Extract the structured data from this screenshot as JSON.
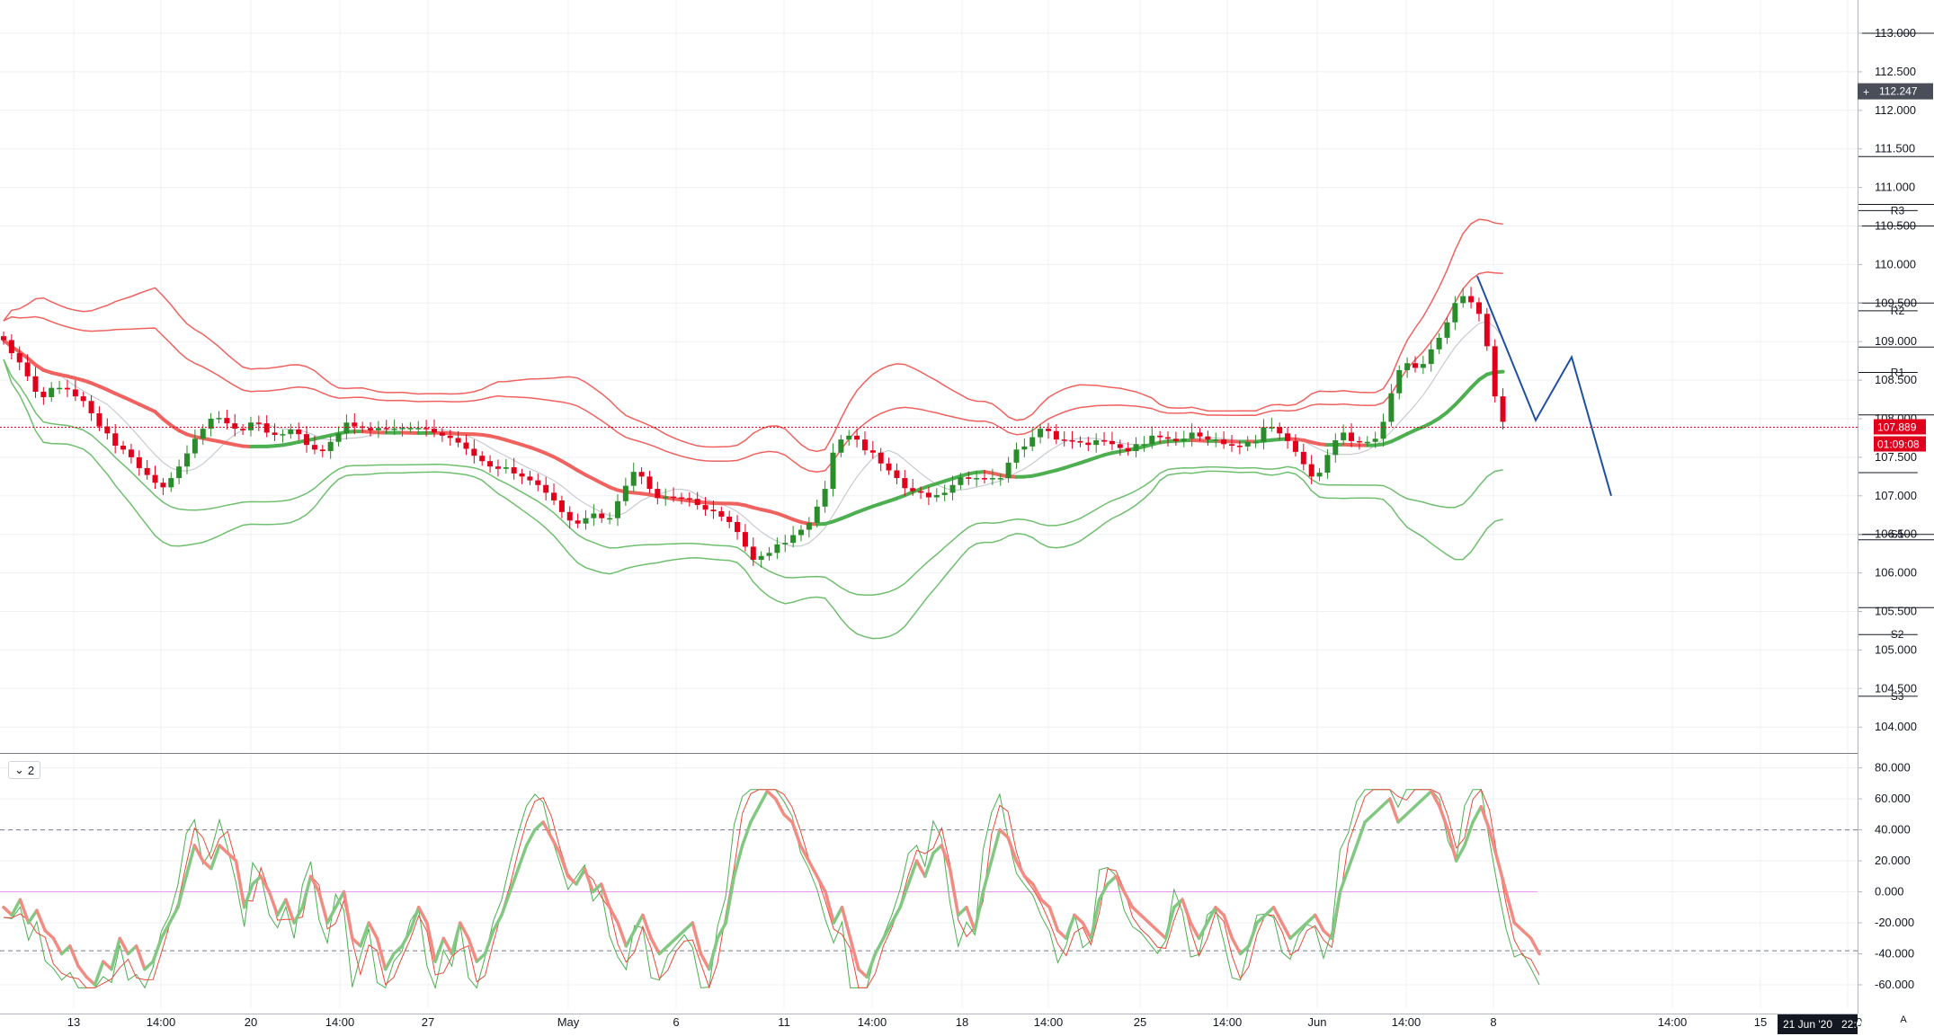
{
  "chart_data": {
    "type": "candlestick",
    "symbol_pane": "main",
    "price_axis": {
      "ylim": [
        103.5,
        113.5
      ],
      "ticks": [
        "113.000",
        "112.500",
        "112.000",
        "111.500",
        "111.000",
        "110.500",
        "110.000",
        "109.500",
        "109.000",
        "108.500",
        "108.000",
        "107.500",
        "107.000",
        "106.500",
        "106.000",
        "105.500",
        "105.000",
        "104.500",
        "104.000"
      ],
      "tick_values": [
        113,
        112.5,
        112,
        111.5,
        111,
        110.5,
        110,
        109.5,
        109,
        108.5,
        108,
        107.5,
        107,
        106.5,
        106,
        105.5,
        105,
        104.5,
        104
      ]
    },
    "time_axis": {
      "labels": [
        "13",
        "14:00",
        "20",
        "14:00",
        "27",
        "May",
        "6",
        "11",
        "14:00",
        "18",
        "14:00",
        "25",
        "14:00",
        "Jun",
        "14:00",
        "8",
        "14:00",
        "15",
        "14:00"
      ],
      "crosshair_label": "21 Jun '20",
      "crosshair_time": "22:00"
    },
    "last_price": "107.889",
    "countdown": "01:09:08",
    "crosshair_price": "112.247",
    "last_price_value": 107.889,
    "crosshair_price_value": 112.247,
    "pivots": [
      {
        "label": "R3",
        "value": 110.7,
        "start_slot": 240,
        "end_slot": 999
      },
      {
        "label": "R2",
        "value": 109.4,
        "start_slot": 240,
        "end_slot": 999
      },
      {
        "label": "R1",
        "value": 108.6,
        "start_slot": 240,
        "end_slot": 999
      },
      {
        "label": "",
        "value": 107.3,
        "start_slot": 240,
        "end_slot": 999
      },
      {
        "label": "S1",
        "value": 106.5,
        "start_slot": 240,
        "end_slot": 999
      },
      {
        "label": "S2",
        "value": 105.2,
        "start_slot": 240,
        "end_slot": 999
      },
      {
        "label": "S3",
        "value": 104.4,
        "start_slot": 240,
        "end_slot": 999
      },
      {
        "label": "R3",
        "value": 113.0,
        "start_slot": 271,
        "end_slot": 302
      },
      {
        "label": "R2",
        "value": 111.4,
        "start_slot": 271,
        "end_slot": 302
      },
      {
        "label": "R1",
        "value": 110.5,
        "start_slot": 271,
        "end_slot": 302
      },
      {
        "label": "P",
        "value": 108.93,
        "start_slot": 271,
        "end_slot": 302
      },
      {
        "label": "S1",
        "value": 108.05,
        "start_slot": 271,
        "end_slot": 302
      },
      {
        "label": "S2",
        "value": 106.5,
        "start_slot": 271,
        "end_slot": 302
      },
      {
        "label": "S3",
        "value": 105.55,
        "start_slot": 271,
        "end_slot": 302
      },
      {
        "label": "R3",
        "value": 110.78,
        "start_slot": 278,
        "end_slot": 285
      },
      {
        "label": "P",
        "value": 109.5,
        "start_slot": 271,
        "end_slot": 278
      },
      {
        "label": "S3",
        "value": 106.43,
        "start_slot": 278,
        "end_slot": 285
      }
    ],
    "closes": [
      109.02,
      108.85,
      108.73,
      108.55,
      108.35,
      108.28,
      108.4,
      108.4,
      108.38,
      108.29,
      108.23,
      108.07,
      107.9,
      107.81,
      107.65,
      107.6,
      107.5,
      107.36,
      107.27,
      107.17,
      107.11,
      107.23,
      107.38,
      107.55,
      107.74,
      107.87,
      108.0,
      108.01,
      107.94,
      107.87,
      107.85,
      107.95,
      107.94,
      107.82,
      107.79,
      107.8,
      107.86,
      107.8,
      107.66,
      107.6,
      107.58,
      107.7,
      107.81,
      107.95,
      107.9,
      107.88,
      107.85,
      107.88,
      107.87,
      107.87,
      107.88,
      107.88,
      107.88,
      107.87,
      107.82,
      107.78,
      107.75,
      107.69,
      107.61,
      107.52,
      107.45,
      107.38,
      107.35,
      107.37,
      107.29,
      107.25,
      107.2,
      107.14,
      107.04,
      106.94,
      106.79,
      106.68,
      106.64,
      106.71,
      106.77,
      106.71,
      106.71,
      106.93,
      107.13,
      107.31,
      107.25,
      107.09,
      106.97,
      106.99,
      106.98,
      106.97,
      106.96,
      106.88,
      106.82,
      106.8,
      106.73,
      106.66,
      106.53,
      106.34,
      106.17,
      106.22,
      106.26,
      106.37,
      106.39,
      106.49,
      106.56,
      106.65,
      106.86,
      107.09,
      107.56,
      107.73,
      107.78,
      107.73,
      107.59,
      107.56,
      107.42,
      107.33,
      107.23,
      107.1,
      107.06,
      107.04,
      106.98,
      107.01,
      107.04,
      107.14,
      107.24,
      107.22,
      107.23,
      107.22,
      107.23,
      107.23,
      107.43,
      107.6,
      107.64,
      107.76,
      107.87,
      107.84,
      107.73,
      107.72,
      107.71,
      107.69,
      107.66,
      107.72,
      107.71,
      107.67,
      107.62,
      107.58,
      107.67,
      107.67,
      107.78,
      107.76,
      107.74,
      107.71,
      107.74,
      107.82,
      107.77,
      107.73,
      107.73,
      107.67,
      107.65,
      107.64,
      107.7,
      107.7,
      107.89,
      107.89,
      107.81,
      107.71,
      107.57,
      107.41,
      107.25,
      107.3,
      107.53,
      107.72,
      107.82,
      107.71,
      107.7,
      107.7,
      107.74,
      107.96,
      108.33,
      108.63,
      108.72,
      108.66,
      108.71,
      108.9,
      109.05,
      109.25,
      109.5,
      109.59,
      109.51,
      109.36,
      108.94,
      108.29,
      107.96
    ]
  },
  "indicator_pane": {
    "pane_label": "2",
    "ylim": [
      -70,
      85
    ],
    "ticks": [
      "80.000",
      "60.000",
      "40.000",
      "20.000",
      "0.000",
      "-20.000",
      "-40.000",
      "-60.000"
    ],
    "tick_values": [
      80,
      60,
      40,
      20,
      0,
      -20,
      -40,
      -60
    ],
    "dashed_levels": [
      40,
      -38
    ],
    "zero_level": 0,
    "thick_line": [
      -10,
      -15,
      -5,
      -20,
      -12,
      -25,
      -30,
      -40,
      -35,
      -48,
      -55,
      -60,
      -45,
      -50,
      -30,
      -40,
      -35,
      -50,
      -45,
      -30,
      -20,
      -10,
      10,
      30,
      20,
      15,
      30,
      25,
      20,
      -10,
      5,
      10,
      0,
      -15,
      -5,
      -20,
      -10,
      10,
      0,
      -20,
      -10,
      0,
      -30,
      -35,
      -20,
      -30,
      -50,
      -40,
      -35,
      -25,
      -10,
      -20,
      -45,
      -30,
      -40,
      -20,
      -30,
      -45,
      -40,
      -25,
      -15,
      0,
      15,
      30,
      40,
      45,
      35,
      25,
      10,
      5,
      15,
      0,
      5,
      -10,
      -20,
      -35,
      -25,
      -15,
      -30,
      -40,
      -35,
      -30,
      -25,
      -20,
      -40,
      -50,
      -30,
      -20,
      10,
      30,
      45,
      55,
      65,
      60,
      50,
      45,
      30,
      20,
      10,
      0,
      -20,
      -10,
      -30,
      -50,
      -55,
      -40,
      -30,
      -20,
      -10,
      5,
      20,
      10,
      25,
      30,
      15,
      -15,
      -10,
      -25,
      0,
      20,
      40,
      35,
      20,
      10,
      5,
      -5,
      -10,
      -25,
      -30,
      -15,
      -20,
      -30,
      -5,
      5,
      10,
      0,
      -10,
      -15,
      -20,
      -25,
      -30,
      -10,
      -5,
      -20,
      -30,
      -20,
      -10,
      -15,
      -30,
      -40,
      -35,
      -20,
      -15,
      -10,
      -20,
      -30,
      -25,
      -20,
      -15,
      -25,
      -30,
      0,
      15,
      30,
      45,
      50,
      55,
      60,
      45,
      50,
      55,
      60,
      65,
      55,
      40,
      20,
      30,
      45,
      55,
      40,
      20,
      0,
      -20,
      -25,
      -30,
      -40
    ]
  },
  "drawings": {
    "blue_path_prices": [
      109.85,
      107.98,
      108.8,
      107.0
    ]
  },
  "colors": {
    "up_candle": "#2a8c2a",
    "down_candle": "#e0001b",
    "ma_red": "#f0625f",
    "ma_green": "#4caf50",
    "band_red": "#f0625f",
    "band_green": "#6fbf6f",
    "blue_drawing": "#1f4fa3",
    "price_badge": "#e0001b",
    "crosshair_badge": "#4a4e59",
    "grid": "#eef0f3",
    "axis_line": "#b2b5be",
    "zero_line": "#e999f0"
  }
}
